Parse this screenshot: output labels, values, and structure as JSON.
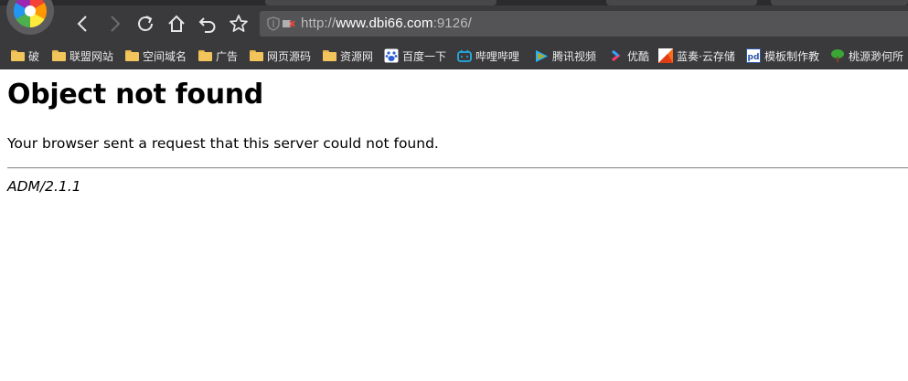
{
  "toolbar": {
    "url_scheme": "http://",
    "url_host": "www.dbi66.com",
    "url_rest": ":9126/"
  },
  "bookmarks": [
    {
      "label": "破",
      "icon": "folder-icon"
    },
    {
      "label": "联盟网站",
      "icon": "folder-icon"
    },
    {
      "label": "空间域名",
      "icon": "folder-icon"
    },
    {
      "label": "广告",
      "icon": "folder-icon"
    },
    {
      "label": "网页源码",
      "icon": "folder-icon"
    },
    {
      "label": "资源网",
      "icon": "folder-icon"
    },
    {
      "label": "百度一下",
      "icon": "baidu-paw-icon"
    },
    {
      "label": "哔哩哔哩",
      "icon": "bilibili-tv-icon"
    },
    {
      "label": "腾讯视频",
      "icon": "tencent-video-play-icon"
    },
    {
      "label": "优酷",
      "icon": "youku-icon"
    },
    {
      "label": "蓝奏·云存储",
      "icon": "lanzou-cloud-icon"
    },
    {
      "label": "模板制作教",
      "icon": "pd-template-icon"
    },
    {
      "label": "桃源渺何所",
      "icon": "tree-icon"
    }
  ],
  "page": {
    "title": "Object not found",
    "message": "Your browser sent a request that this server could not found.",
    "footer": "ADM/2.1.1"
  },
  "colors": {
    "chrome_bg": "#3a3a3c",
    "urlbar_bg": "#545457",
    "folder": "#f2c55c",
    "page_bg": "#ffffff"
  }
}
